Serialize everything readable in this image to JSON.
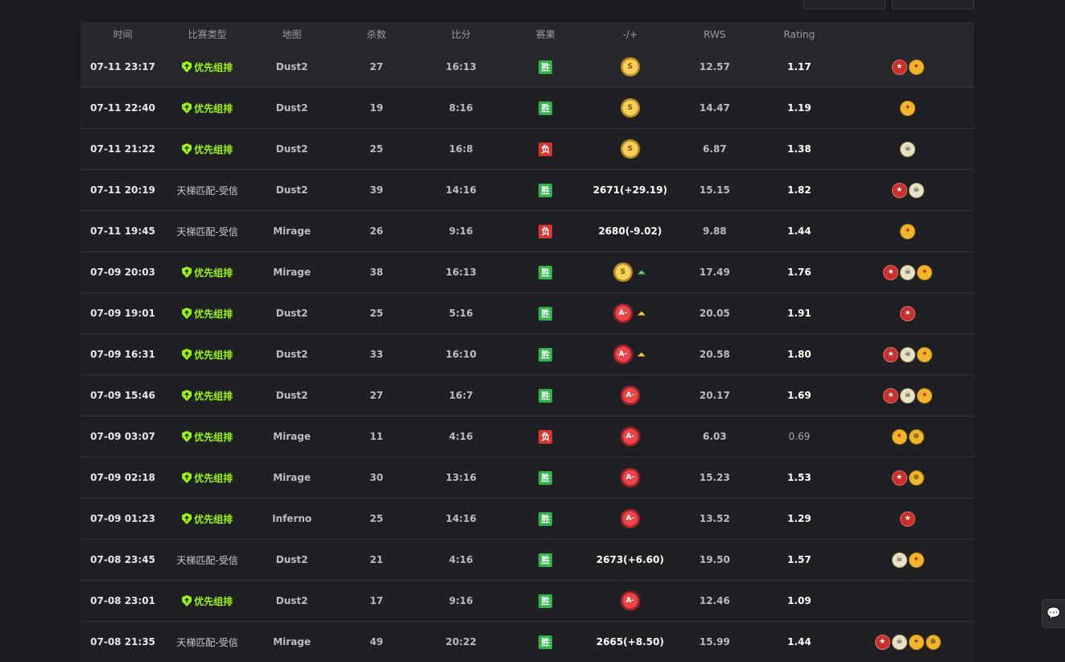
{
  "headers": [
    "时间",
    "比赛类型",
    "地图",
    "杀数",
    "比分",
    "赛果",
    "-/+",
    "RWS",
    "Rating",
    ""
  ],
  "rows": [
    {
      "time": "07-11 23:17",
      "type": "优先组排",
      "prio": true,
      "map": "Dust2",
      "kills": "27",
      "score": "16:13",
      "result": "胜",
      "win": true,
      "delta": "",
      "medal": "s",
      "arrow": "",
      "rws": "12.57",
      "rating": "1.17",
      "badges": [
        "star",
        "gun"
      ]
    },
    {
      "time": "07-11 22:40",
      "type": "优先组排",
      "prio": true,
      "map": "Dust2",
      "kills": "19",
      "score": "8:16",
      "result": "胜",
      "win": true,
      "delta": "",
      "medal": "s",
      "arrow": "",
      "rws": "14.47",
      "rating": "1.19",
      "badges": [
        "gun"
      ]
    },
    {
      "time": "07-11 21:22",
      "type": "优先组排",
      "prio": true,
      "map": "Dust2",
      "kills": "25",
      "score": "16:8",
      "result": "负",
      "win": false,
      "delta": "",
      "medal": "s",
      "arrow": "",
      "rws": "6.87",
      "rating": "1.38",
      "badges": [
        "skull"
      ]
    },
    {
      "time": "07-11 20:19",
      "type": "天梯匹配-受信",
      "prio": false,
      "map": "Dust2",
      "kills": "39",
      "score": "14:16",
      "result": "胜",
      "win": true,
      "delta": "2671(+29.19)",
      "medal": "",
      "arrow": "",
      "rws": "15.15",
      "rating": "1.82",
      "badges": [
        "star",
        "skull"
      ]
    },
    {
      "time": "07-11 19:45",
      "type": "天梯匹配-受信",
      "prio": false,
      "map": "Mirage",
      "kills": "26",
      "score": "9:16",
      "result": "负",
      "win": false,
      "delta": "2680(-9.02)",
      "medal": "",
      "arrow": "",
      "rws": "9.88",
      "rating": "1.44",
      "badges": [
        "gun"
      ]
    },
    {
      "time": "07-09 20:03",
      "type": "优先组排",
      "prio": true,
      "map": "Mirage",
      "kills": "38",
      "score": "16:13",
      "result": "胜",
      "win": true,
      "delta": "",
      "medal": "s",
      "arrow": "green",
      "rws": "17.49",
      "rating": "1.76",
      "badges": [
        "star",
        "skull",
        "gun"
      ]
    },
    {
      "time": "07-09 19:01",
      "type": "优先组排",
      "prio": true,
      "map": "Dust2",
      "kills": "25",
      "score": "5:16",
      "result": "胜",
      "win": true,
      "delta": "",
      "medal": "a",
      "arrow": "yellow",
      "rws": "20.05",
      "rating": "1.91",
      "badges": [
        "star"
      ]
    },
    {
      "time": "07-09 16:31",
      "type": "优先组排",
      "prio": true,
      "map": "Dust2",
      "kills": "33",
      "score": "16:10",
      "result": "胜",
      "win": true,
      "delta": "",
      "medal": "a",
      "arrow": "yellow",
      "rws": "20.58",
      "rating": "1.80",
      "badges": [
        "star",
        "skull",
        "gun"
      ]
    },
    {
      "time": "07-09 15:46",
      "type": "优先组排",
      "prio": true,
      "map": "Dust2",
      "kills": "27",
      "score": "16:7",
      "result": "胜",
      "win": true,
      "delta": "",
      "medal": "a",
      "arrow": "",
      "rws": "20.17",
      "rating": "1.69",
      "badges": [
        "star",
        "skull",
        "gun"
      ]
    },
    {
      "time": "07-09 03:07",
      "type": "优先组排",
      "prio": true,
      "map": "Mirage",
      "kills": "11",
      "score": "4:16",
      "result": "负",
      "win": false,
      "delta": "",
      "medal": "a",
      "arrow": "",
      "rws": "6.03",
      "rating": "0.69",
      "badges": [
        "gun",
        "cross"
      ]
    },
    {
      "time": "07-09 02:18",
      "type": "优先组排",
      "prio": true,
      "map": "Mirage",
      "kills": "30",
      "score": "13:16",
      "result": "胜",
      "win": true,
      "delta": "",
      "medal": "a",
      "arrow": "",
      "rws": "15.23",
      "rating": "1.53",
      "badges": [
        "star",
        "cross"
      ]
    },
    {
      "time": "07-09 01:23",
      "type": "优先组排",
      "prio": true,
      "map": "Inferno",
      "kills": "25",
      "score": "14:16",
      "result": "胜",
      "win": true,
      "delta": "",
      "medal": "a",
      "arrow": "",
      "rws": "13.52",
      "rating": "1.29",
      "badges": [
        "star"
      ]
    },
    {
      "time": "07-08 23:45",
      "type": "天梯匹配-受信",
      "prio": false,
      "map": "Dust2",
      "kills": "21",
      "score": "4:16",
      "result": "胜",
      "win": true,
      "delta": "2673(+6.60)",
      "medal": "",
      "arrow": "",
      "rws": "19.50",
      "rating": "1.57",
      "badges": [
        "skull",
        "gun"
      ]
    },
    {
      "time": "07-08 23:01",
      "type": "优先组排",
      "prio": true,
      "map": "Dust2",
      "kills": "17",
      "score": "9:16",
      "result": "胜",
      "win": true,
      "delta": "",
      "medal": "a",
      "arrow": "",
      "rws": "12.46",
      "rating": "1.09",
      "badges": []
    },
    {
      "time": "07-08 21:35",
      "type": "天梯匹配-受信",
      "prio": false,
      "map": "Mirage",
      "kills": "49",
      "score": "20:22",
      "result": "胜",
      "win": true,
      "delta": "2665(+8.50)",
      "medal": "",
      "arrow": "",
      "rws": "15.99",
      "rating": "1.44",
      "badges": [
        "star",
        "skull",
        "gun",
        "cross"
      ]
    }
  ],
  "medals": {
    "s": "S",
    "a": "A-"
  },
  "icons": {
    "prio": "shield-arrow-icon",
    "chat": "chat-bubble-icon",
    "star": "star-badge-icon",
    "skull": "skull-badge-icon",
    "gun": "gun-badge-icon",
    "cross": "crosshair-badge-icon"
  },
  "colors": {
    "win": "#2fb34a",
    "lose": "#d8322f",
    "prio": "#9bf50f",
    "bg": "#1b1c1f"
  }
}
